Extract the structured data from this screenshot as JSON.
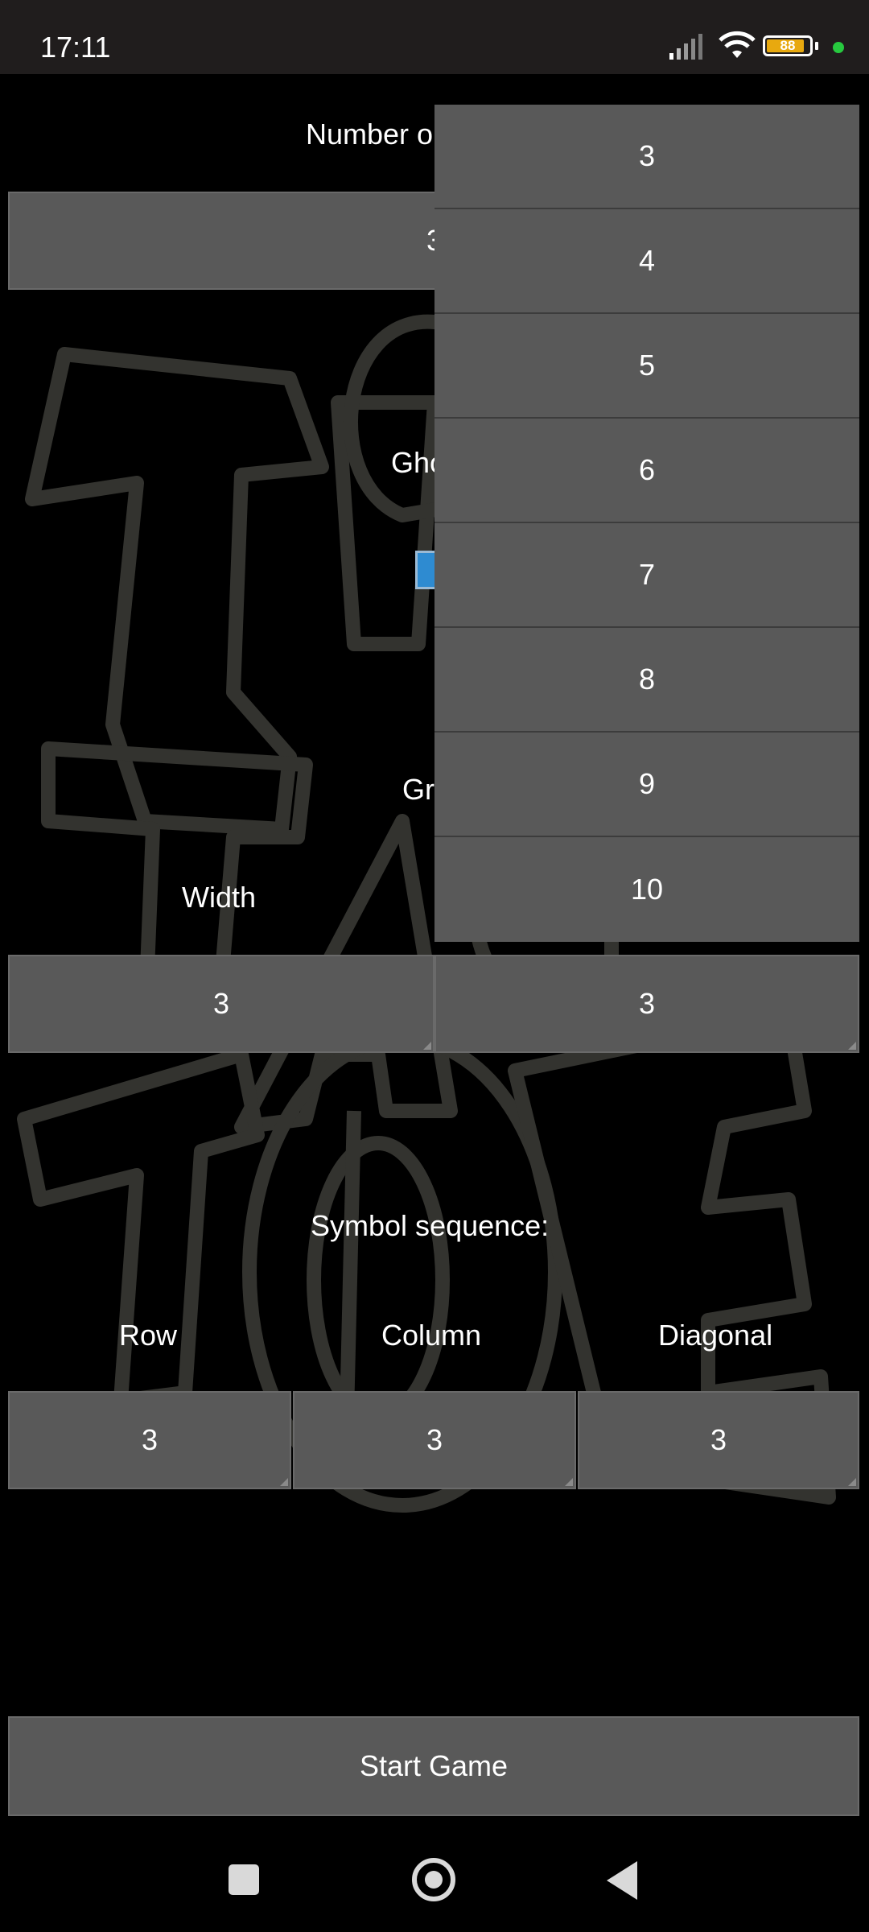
{
  "status_bar": {
    "time": "17:11",
    "battery_level": "88",
    "battery_fraction": 0.88
  },
  "setup": {
    "number_label": "Number o",
    "number_value": "3",
    "ghost_label": "Gho",
    "grid_label": "Gr",
    "width_label": "Width",
    "width_value": "3",
    "height_value": "3",
    "symbol_sequence_label": "Symbol sequence:",
    "row_label": "Row",
    "column_label": "Column",
    "diagonal_label": "Diagonal",
    "row_value": "3",
    "column_value": "3",
    "diagonal_value": "3",
    "start_button": "Start Game"
  },
  "dropdown": {
    "options": [
      "3",
      "4",
      "5",
      "6",
      "7",
      "8",
      "9",
      "10"
    ]
  },
  "nav_bar": {
    "icons": [
      "recents-square-icon",
      "home-circle-icon",
      "back-triangle-icon"
    ]
  },
  "colors": {
    "background": "#000000",
    "field": "#595959",
    "statusbar": "#201d1d",
    "art_stroke": "#33332f"
  }
}
